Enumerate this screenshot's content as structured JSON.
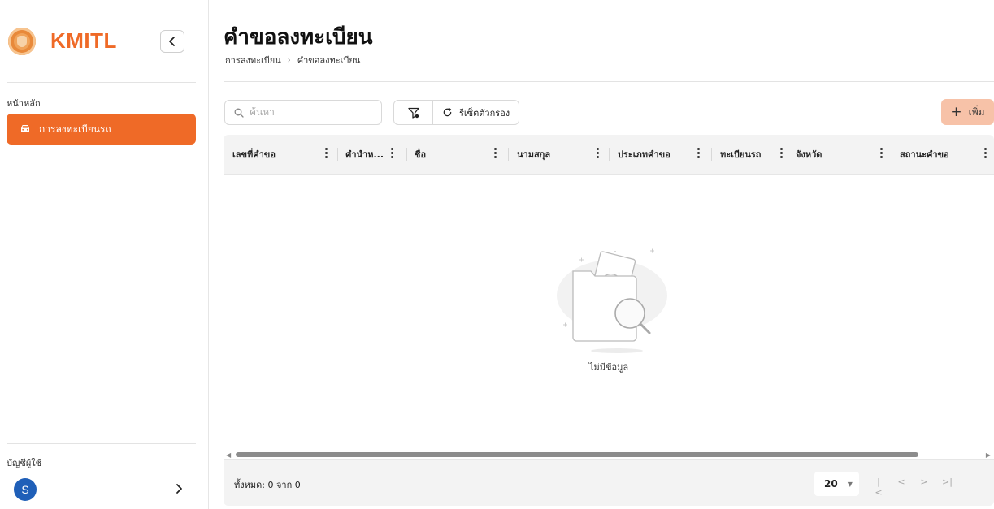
{
  "app": {
    "logo_text": "KMITL"
  },
  "sidebar": {
    "section_label": "หน้าหลัก",
    "items": [
      {
        "label": "การลงทะเบียนรถ",
        "icon": "car-icon",
        "active": true
      }
    ],
    "account": {
      "label": "บัญชีผู้ใช้",
      "avatar_initial": "S"
    }
  },
  "header": {
    "title": "คำขอลงทะเบียน",
    "breadcrumb": [
      "การลงทะเบียน",
      "คำขอลงทะเบียน"
    ]
  },
  "toolbar": {
    "search_placeholder": "ค้นหา",
    "reset_label": "รีเซ็ตตัวกรอง",
    "add_label": "เพิ่ม"
  },
  "table": {
    "columns": [
      "เลขที่คำขอ",
      "คำนำห...",
      "ชื่อ",
      "นามสกุล",
      "ประเภทคำขอ",
      "ทะเบียนรถ",
      "จังหวัด",
      "สถานะคำขอ"
    ],
    "rows": [],
    "empty_text": "ไม่มีข้อมูล",
    "total_text": "ทั้งหมด: 0 จาก 0",
    "page_size": "20"
  },
  "colors": {
    "accent": "#ef6a27",
    "add_button_bg": "#f7c2a8",
    "avatar_bg": "#1f5fb8"
  }
}
